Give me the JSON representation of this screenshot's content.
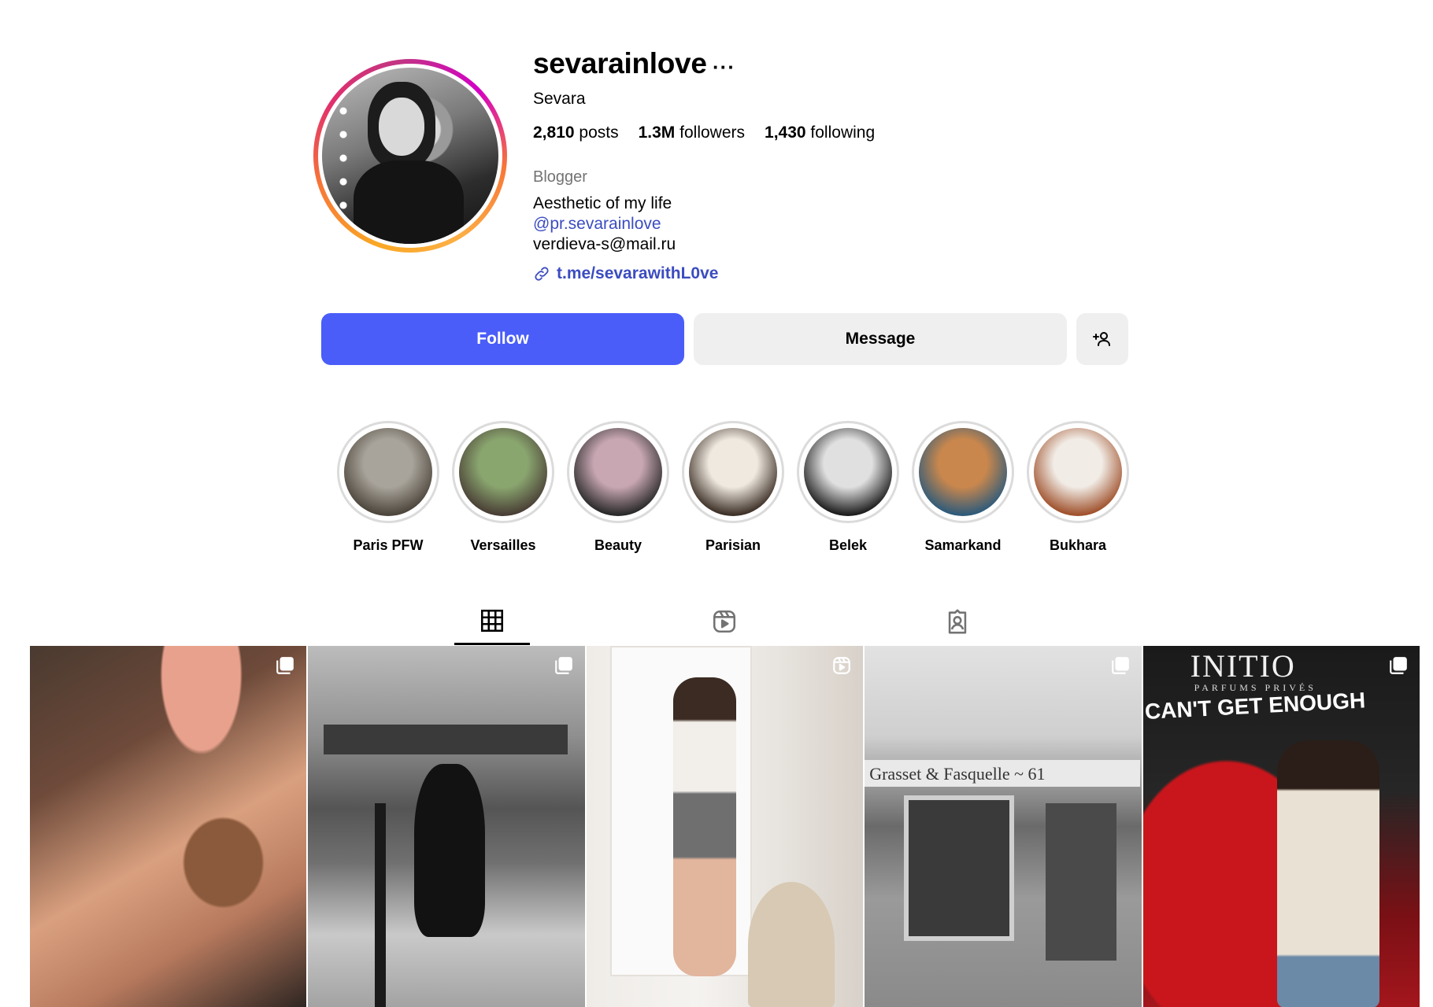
{
  "profile": {
    "username": "sevarainlove",
    "more_icon": "···",
    "full_name": "Sevara",
    "stats": [
      {
        "value": "2,810",
        "label": "posts"
      },
      {
        "value": "1.3M",
        "label": "followers"
      },
      {
        "value": "1,430",
        "label": "following"
      }
    ],
    "category": "Blogger",
    "bio_line": "Aesthetic of my life",
    "mention": "@pr.sevarainlove",
    "email": "verdieva-s@mail.ru",
    "link": "t.me/sevarawithL0ve"
  },
  "actions": {
    "follow": "Follow",
    "message": "Message",
    "add_user_icon": "person-add-icon"
  },
  "highlights": [
    {
      "label": "Paris PFW",
      "c1": "#a9a49b",
      "c2": "#4d463d"
    },
    {
      "label": "Versailles",
      "c1": "#8aa66f",
      "c2": "#4a3f36"
    },
    {
      "label": "Beauty",
      "c1": "#c8a7b3",
      "c2": "#2a2a2a"
    },
    {
      "label": "Parisian",
      "c1": "#efe9df",
      "c2": "#3e3128"
    },
    {
      "label": "Belek",
      "c1": "#e0e0e0",
      "c2": "#1e1e1e"
    },
    {
      "label": "Samarkand",
      "c1": "#c9874d",
      "c2": "#2f5b7a"
    },
    {
      "label": "Bukhara",
      "c1": "#f1ece6",
      "c2": "#a0522d"
    }
  ],
  "tabs": [
    {
      "icon": "grid-icon",
      "active": true
    },
    {
      "icon": "reels-icon",
      "active": false
    },
    {
      "icon": "tagged-icon",
      "active": false
    }
  ],
  "posts": [
    {
      "badge": "multiple-posts-icon"
    },
    {
      "badge": "multiple-posts-icon"
    },
    {
      "badge": "reel-icon"
    },
    {
      "badge": "multiple-posts-icon"
    },
    {
      "badge": "multiple-posts-icon"
    }
  ],
  "post_texts": {
    "shop_sign": "Grasset & Fasquelle ~ 61",
    "brand": "INITIO",
    "brand_sub": "PARFUMS PRIVÉS",
    "slogan": "CAN'T GET ENOUGH"
  }
}
